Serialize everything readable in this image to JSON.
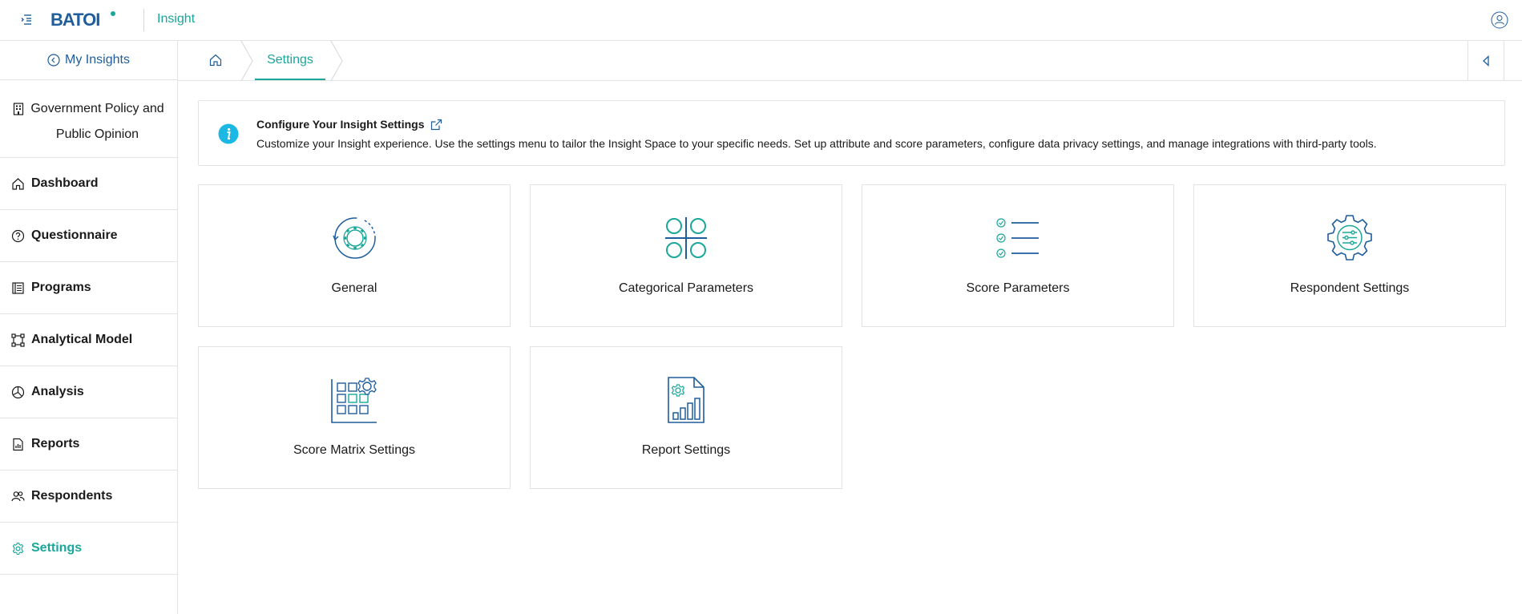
{
  "header": {
    "logo_text": "BATOI",
    "app_name": "Insight"
  },
  "sidebar": {
    "back_label": "My Insights",
    "project_title": "Government Policy and Public Opinion",
    "items": [
      {
        "label": "Dashboard"
      },
      {
        "label": "Questionnaire"
      },
      {
        "label": "Programs"
      },
      {
        "label": "Analytical Model"
      },
      {
        "label": "Analysis"
      },
      {
        "label": "Reports"
      },
      {
        "label": "Respondents"
      },
      {
        "label": "Settings"
      }
    ]
  },
  "breadcrumb": {
    "current": "Settings"
  },
  "info": {
    "title": "Configure Your Insight Settings",
    "description": "Customize your Insight experience. Use the settings menu to tailor the Insight Space to your specific needs. Set up attribute and score parameters, configure data privacy settings, and manage integrations with third-party tools."
  },
  "cards": [
    {
      "label": "General"
    },
    {
      "label": "Categorical Parameters"
    },
    {
      "label": "Score Parameters"
    },
    {
      "label": "Respondent Settings"
    },
    {
      "label": "Score Matrix Settings"
    },
    {
      "label": "Report Settings"
    }
  ],
  "colors": {
    "accent": "#1aa79a",
    "brand_blue": "#1f5d9c",
    "info_icon": "#1bb8e3",
    "border": "#e3e3e3"
  }
}
